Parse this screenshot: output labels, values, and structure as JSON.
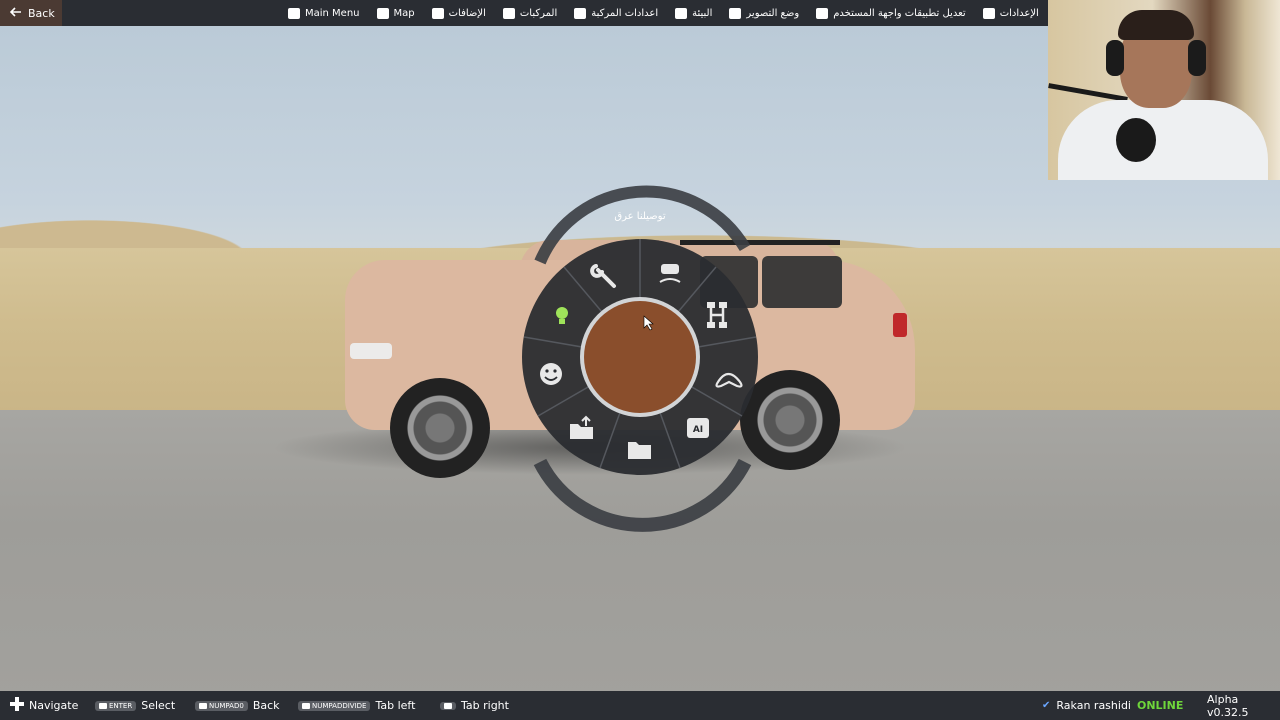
{
  "topbar": {
    "back_label": "Back",
    "items": [
      {
        "label": "Main Menu",
        "icon": "grid-icon"
      },
      {
        "label": "Map",
        "icon": "map-icon"
      },
      {
        "label": "الإضافات",
        "icon": "puzzle-icon"
      },
      {
        "label": "المركبات",
        "icon": "car-icon"
      },
      {
        "label": "اعدادات المركبة",
        "icon": "engine-icon"
      },
      {
        "label": "البيئة",
        "icon": "weather-icon"
      },
      {
        "label": "وضع التصوير",
        "icon": "camera-icon"
      },
      {
        "label": "تعديل تطبيقات واجهة المستخدم",
        "icon": "ui-apps-icon"
      },
      {
        "label": "الإعدادات",
        "icon": "sliders-icon"
      }
    ]
  },
  "radial_menu": {
    "title": "توصيلنا عرق",
    "segments": [
      {
        "icon": "wrench-icon"
      },
      {
        "icon": "car-drive-icon"
      },
      {
        "icon": "drivetrain-icon"
      },
      {
        "icon": "gamepad-icon"
      },
      {
        "icon": "ai-chip-icon"
      },
      {
        "icon": "folder-open-icon"
      },
      {
        "icon": "folder-upload-icon"
      },
      {
        "icon": "smiley-icon"
      },
      {
        "icon": "lightbulb-icon"
      }
    ],
    "center_color": "#8a4e2c"
  },
  "bottombar": {
    "hints": [
      {
        "key": "",
        "label": "Navigate"
      },
      {
        "key": "ENTER",
        "label": "Select"
      },
      {
        "key": "NUMPAD0",
        "label": "Back"
      },
      {
        "key": "NUMPADDIVIDE",
        "label": "Tab left"
      },
      {
        "key": "",
        "label": "Tab right"
      }
    ],
    "user_name": "Rakan rashidi",
    "status": "ONLINE",
    "version": "Alpha v0.32.5"
  },
  "colors": {
    "topbar_bg": "#2a2d33",
    "back_bg": "#4b3a33",
    "online": "#6fd63b"
  }
}
